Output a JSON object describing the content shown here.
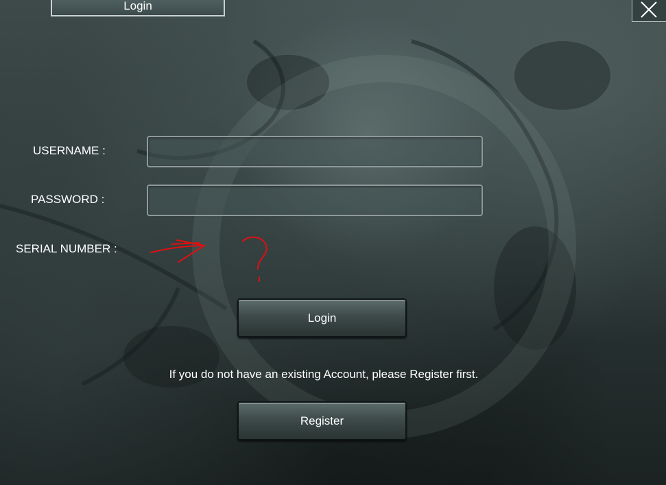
{
  "window": {
    "title": "Login",
    "close_icon": "close-icon"
  },
  "form": {
    "username_label": "USERNAME :",
    "username_value": "",
    "password_label": "PASSWORD :",
    "password_value": "",
    "serial_label": "SERIAL NUMBER :"
  },
  "buttons": {
    "login_label": "Login",
    "register_label": "Register"
  },
  "info": {
    "register_hint": "If you do not have an existing Account, please Register first."
  },
  "annotation": {
    "arrow_icon": "red-arrow-icon",
    "question_icon": "red-question-mark-icon",
    "color": "#e01010"
  },
  "theme": {
    "background": "#2f3a3a",
    "text": "#ffffff",
    "field_border": "#8e9a99"
  }
}
